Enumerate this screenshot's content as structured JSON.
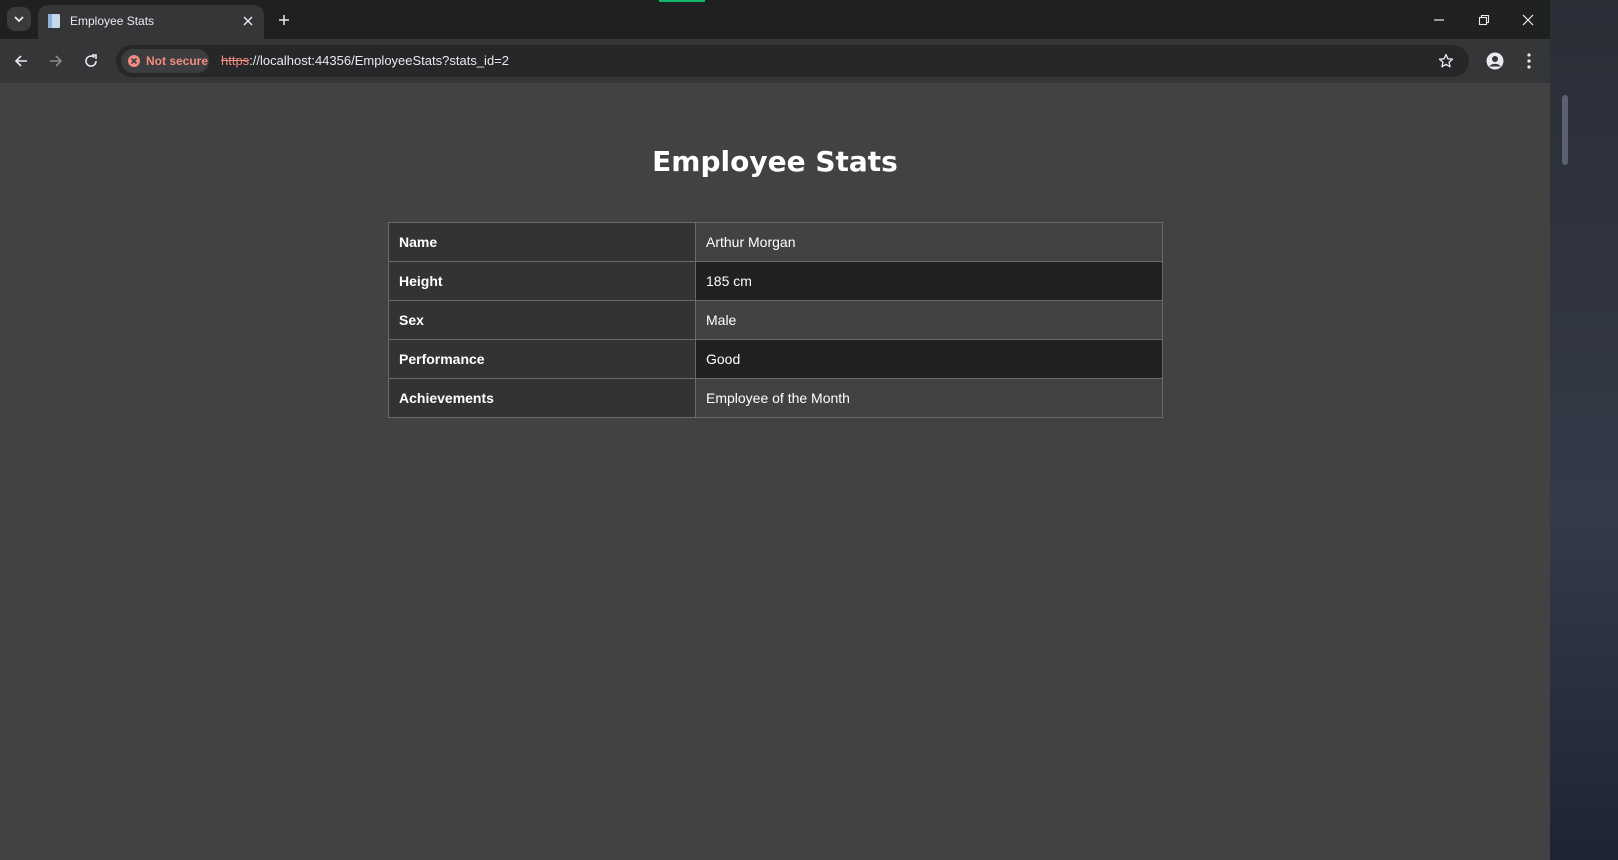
{
  "browser": {
    "tab_title": "Employee Stats",
    "security_label": "Not secure",
    "url_scheme": "https",
    "url_rest": "://localhost:44356/EmployeeStats?stats_id=2"
  },
  "page": {
    "title": "Employee Stats",
    "rows": [
      {
        "label": "Name",
        "value": "Arthur Morgan"
      },
      {
        "label": "Height",
        "value": "185 cm"
      },
      {
        "label": "Sex",
        "value": "Male"
      },
      {
        "label": "Performance",
        "value": "Good"
      },
      {
        "label": "Achievements",
        "value": "Employee of the Month"
      }
    ]
  },
  "colors": {
    "page_bg": "#424242",
    "key_cell_bg": "#333333",
    "alt_row_bg": "#212121",
    "warning": "#f28b82"
  }
}
